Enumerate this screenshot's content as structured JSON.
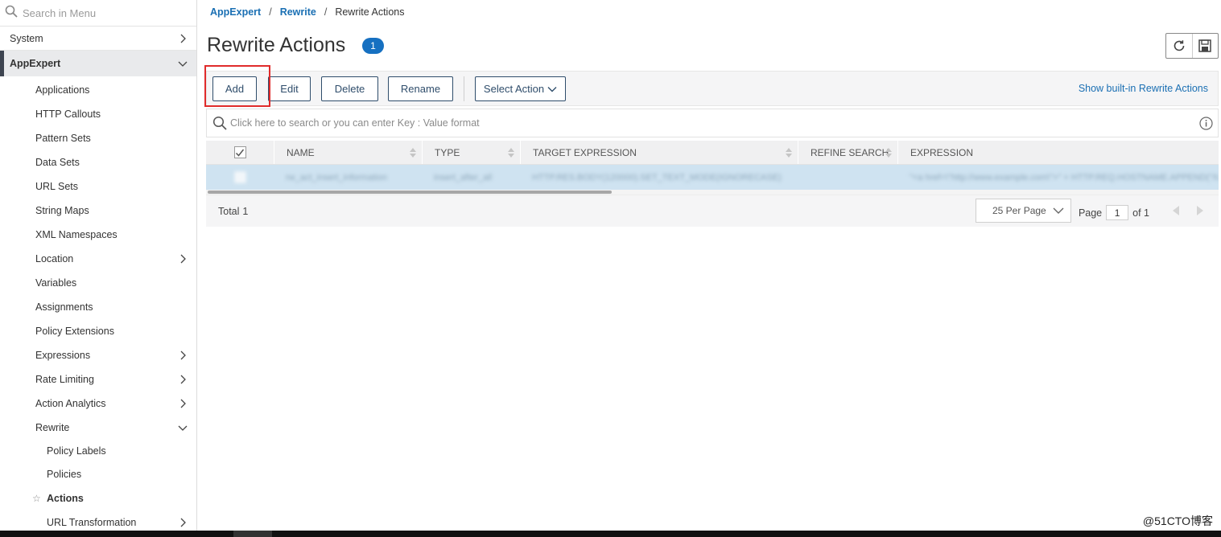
{
  "sidebar": {
    "search_placeholder": "Search in Menu",
    "system_label": "System",
    "appexpert_label": "AppExpert",
    "items": [
      {
        "label": "Applications"
      },
      {
        "label": "HTTP Callouts"
      },
      {
        "label": "Pattern Sets"
      },
      {
        "label": "Data Sets"
      },
      {
        "label": "URL Sets"
      },
      {
        "label": "String Maps"
      },
      {
        "label": "XML Namespaces"
      },
      {
        "label": "Location"
      },
      {
        "label": "Variables"
      },
      {
        "label": "Assignments"
      },
      {
        "label": "Policy Extensions"
      },
      {
        "label": "Expressions"
      },
      {
        "label": "Rate Limiting"
      },
      {
        "label": "Action Analytics"
      },
      {
        "label": "Rewrite"
      }
    ],
    "rewrite_children": [
      {
        "label": "Policy Labels"
      },
      {
        "label": "Policies"
      },
      {
        "label": "Actions"
      },
      {
        "label": "URL Transformation"
      }
    ]
  },
  "breadcrumb": {
    "level1": "AppExpert",
    "level2": "Rewrite",
    "current": "Rewrite Actions",
    "separator": "/"
  },
  "page": {
    "title": "Rewrite Actions",
    "count": "1"
  },
  "toolbar": {
    "add": "Add",
    "edit": "Edit",
    "delete": "Delete",
    "rename": "Rename",
    "select_action": "Select Action",
    "show_builtin": "Show built-in Rewrite Actions"
  },
  "search": {
    "placeholder": "Click here to search or you can enter Key : Value format"
  },
  "table": {
    "columns": {
      "name": "NAME",
      "type": "TYPE",
      "target": "TARGET EXPRESSION",
      "refine": "REFINE SEARCH",
      "expression": "EXPRESSION"
    },
    "rows": [
      {
        "name": "rw_act_insert_information",
        "type": "insert_after_all",
        "target": "HTTP.RES.BODY(120000).SET_TEXT_MODE(IGNORECASE)",
        "refine": "",
        "expression": "\"<a href=\\\"http://www.example.com\\\">\" + HTTP.REQ.HOSTNAME.APPEND(\"/target\") + \""
      }
    ]
  },
  "footer": {
    "total_label": "Total",
    "total_value": "1",
    "per_page": "25 Per Page",
    "page_label": "Page",
    "page_value": "1",
    "of_label": "of 1"
  },
  "watermark": "@51CTO博客",
  "colors": {
    "accent": "#1670c1",
    "link": "#1a6fb3",
    "highlight": "#e02b2b",
    "selected_row": "#cfe3f1"
  }
}
